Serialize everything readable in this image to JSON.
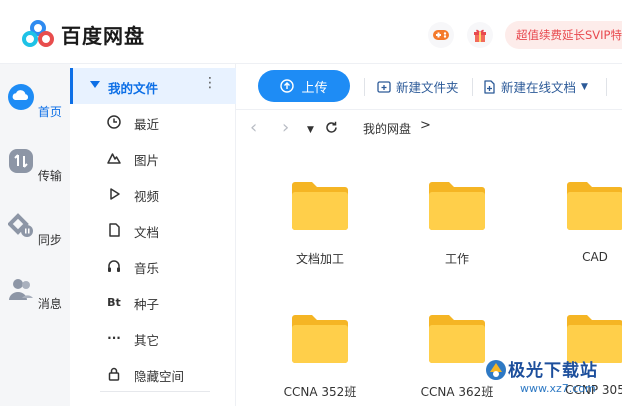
{
  "header": {
    "brand": "百度网盘",
    "promo_text": "超值续费延长SVIP特",
    "icons": [
      "baidu-netdisk-logo",
      "game-controller-icon",
      "gift-icon"
    ]
  },
  "rail": {
    "items": [
      {
        "label": "首页",
        "icon": "cloud-home-icon",
        "active": true
      },
      {
        "label": "传输",
        "icon": "transfer-icon",
        "active": false
      },
      {
        "label": "同步",
        "icon": "sync-icon",
        "active": false
      },
      {
        "label": "消息",
        "icon": "people-message-icon",
        "active": false
      }
    ]
  },
  "nav": {
    "header_label": "我的文件",
    "more_symbol": "⋮",
    "items": [
      {
        "label": "最近",
        "icon": "clock-icon"
      },
      {
        "label": "图片",
        "icon": "image-icon"
      },
      {
        "label": "视频",
        "icon": "play-icon"
      },
      {
        "label": "文档",
        "icon": "document-icon"
      },
      {
        "label": "音乐",
        "icon": "headphones-icon"
      },
      {
        "label": "种子",
        "icon": "bt-icon",
        "glyph": "Bt"
      },
      {
        "label": "其它",
        "icon": "ellipsis-icon",
        "glyph": "···"
      },
      {
        "label": "隐藏空间",
        "icon": "lock-icon"
      }
    ]
  },
  "toolbar": {
    "upload_label": "上传",
    "new_folder_label": "新建文件夹",
    "new_online_doc_label": "新建在线文档"
  },
  "breadcrumb": {
    "root": "我的网盘",
    "separator": ">"
  },
  "files": [
    {
      "name": "文档加工",
      "type": "folder"
    },
    {
      "name": "工作",
      "type": "folder"
    },
    {
      "name": "CAD",
      "type": "folder"
    },
    {
      "name": "CCNA 352班",
      "type": "folder"
    },
    {
      "name": "CCNA 362班",
      "type": "folder"
    },
    {
      "name": "CCNP 305",
      "type": "folder"
    }
  ],
  "watermark": {
    "title": "极光下载站",
    "url": "www.xz7.com"
  },
  "colors": {
    "accent": "#1e8cf5",
    "active_text": "#0d6fe6",
    "promo_text": "#e8494f",
    "folder": "#ffc83d"
  }
}
